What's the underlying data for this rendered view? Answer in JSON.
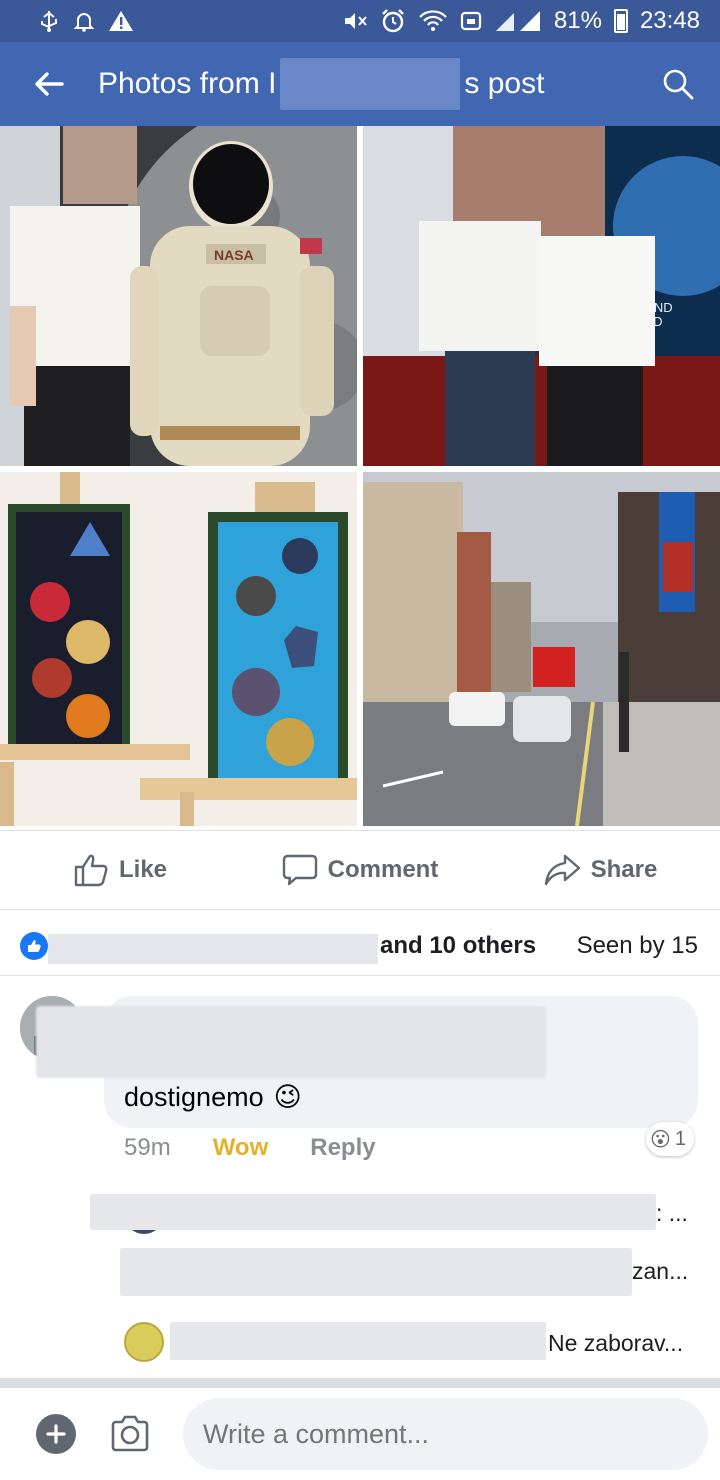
{
  "status_bar": {
    "battery": "81%",
    "time": "23:48",
    "icons_left": [
      "usb-icon",
      "bell-icon",
      "warning-icon"
    ],
    "icons_right": [
      "mute-icon",
      "alarm-icon",
      "wifi-icon",
      "vpn-icon",
      "signal-icon"
    ]
  },
  "appbar": {
    "title_start": "Photos from I",
    "title_end": "s post"
  },
  "photos": [
    {
      "label": "astronaut-suit-photo"
    },
    {
      "label": "couple-poster-photo"
    },
    {
      "label": "mission-patches-photo"
    },
    {
      "label": "london-street-photo"
    }
  ],
  "actions": {
    "like": "Like",
    "comment": "Comment",
    "share": "Share"
  },
  "reactions": {
    "others": "and 10 others",
    "seen": "Seen by 15"
  },
  "comment": {
    "text": "dostignemo",
    "emoji": "😉",
    "time": "59m",
    "wow": "Wow",
    "reply": "Reply",
    "react_count": "1",
    "react_emoji": "😮"
  },
  "replies": [
    {
      "text": ": ..."
    },
    {
      "text": "zan..."
    },
    {
      "text": "Ne zaborav..."
    }
  ],
  "composer": {
    "placeholder": "Write a comment..."
  },
  "colors": {
    "status_bar": "#3b5998",
    "app_bar": "#4267b2",
    "like_blue": "#1877f2",
    "wow_yellow": "#e3b22b"
  }
}
